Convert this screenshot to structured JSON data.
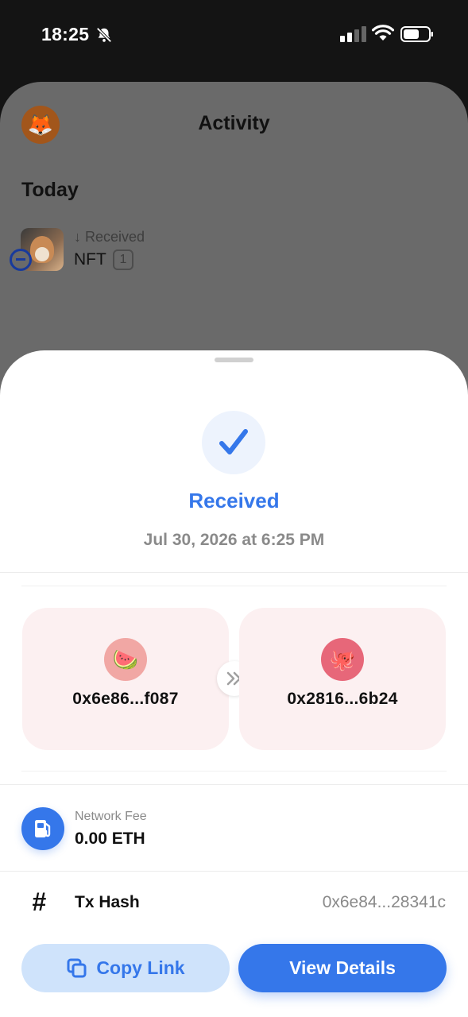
{
  "status_bar": {
    "time": "18:25",
    "icons": [
      "bell-muted-icon",
      "cellular-signal-icon",
      "wifi-icon",
      "battery-icon"
    ]
  },
  "background": {
    "title": "Activity",
    "section": "Today",
    "activity": {
      "direction_arrow": "↓",
      "type": "Received",
      "asset": "NFT",
      "count": "1"
    },
    "avatar_emoji": "🦊"
  },
  "sheet": {
    "status": "Received",
    "date": "Jul 30, 2026 at 6:25 PM",
    "from": {
      "emoji": "🍉",
      "address": "0x6e86...f087"
    },
    "to": {
      "emoji": "🐙",
      "address": "0x2816...6b24"
    },
    "network_fee": {
      "label": "Network Fee",
      "value": "0.00 ETH"
    },
    "tx_hash": {
      "symbol": "#",
      "label": "Tx Hash",
      "value": "0x6e84...28341c"
    },
    "buttons": {
      "copy_link": "Copy Link",
      "view_details": "View Details"
    }
  },
  "colors": {
    "accent": "#3577ea",
    "accent_light": "#cfe3fb",
    "card_bg": "#fcf0f1",
    "muted_text": "#8a8a8a"
  }
}
